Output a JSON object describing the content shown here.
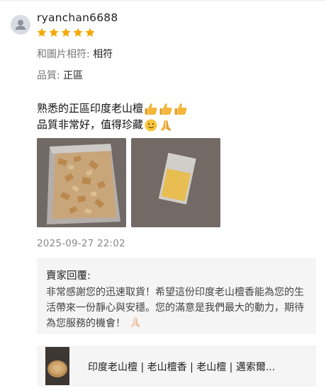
{
  "review": {
    "username": "ryanchan6688",
    "rating": 5,
    "star_color": "#f6a700",
    "attributes": [
      {
        "label": "和圖片相符:",
        "value": "相符"
      },
      {
        "label": "品質:",
        "value": "正區"
      }
    ],
    "comment_lines": [
      "熟悉的正區印度老山檀",
      "品質非常好，值得珍藏"
    ],
    "comment_emojis": [
      "thumbs-up-icon",
      "thumbs-up-icon",
      "thumbs-up-icon",
      "slight-smile-icon",
      "praying-hands-icon"
    ],
    "photos": [
      "sandalwood-chips-bag-photo",
      "sandalwood-powder-bag-photo"
    ],
    "date": "2025-09-27 22:02"
  },
  "seller_reply": {
    "title": "賣家回覆:",
    "body": "非常感謝您的迅速取貨！希望這份印度老山檀香能為您的生活帶來一份靜心與安穩。您的滿意是我們最大的動力，期待為您服務的機會！"
  },
  "product": {
    "name": "印度老山檀 | 老山檀香 | 老山檀 | 邁索爾...",
    "thumbnail": "sandalwood-bowl-photo"
  }
}
